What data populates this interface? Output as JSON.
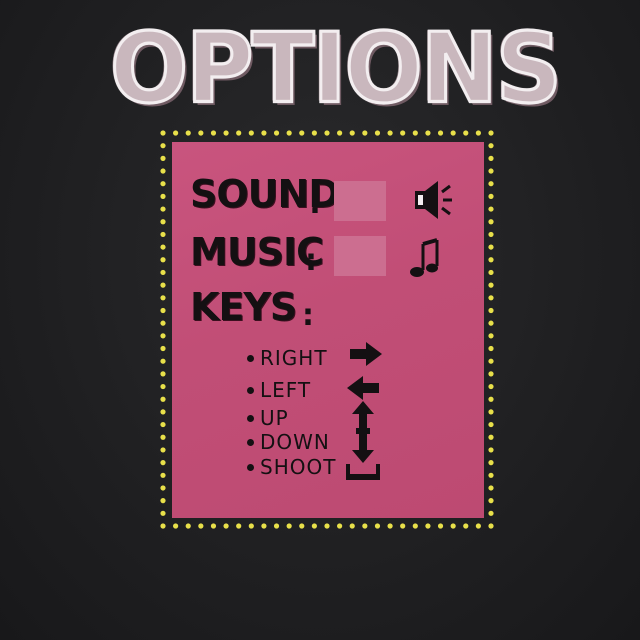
{
  "title": "OPTIONS",
  "options": {
    "sound_label": "SOUND",
    "music_label": "MUSIC",
    "keys_label": "KEYS",
    "colon": ":"
  },
  "keys": [
    {
      "label": "RIGHT",
      "icon": "arrow-right-icon"
    },
    {
      "label": "LEFT",
      "icon": "arrow-left-icon"
    },
    {
      "label": "UP",
      "icon": "arrow-up-icon"
    },
    {
      "label": "DOWN",
      "icon": "arrow-down-icon"
    },
    {
      "label": "SHOOT",
      "icon": "spacebar-icon"
    }
  ],
  "colors": {
    "background": "#1f1f21",
    "panel": "#c14e76",
    "dots": "#e8e04a",
    "title": "#c9b7bd"
  }
}
